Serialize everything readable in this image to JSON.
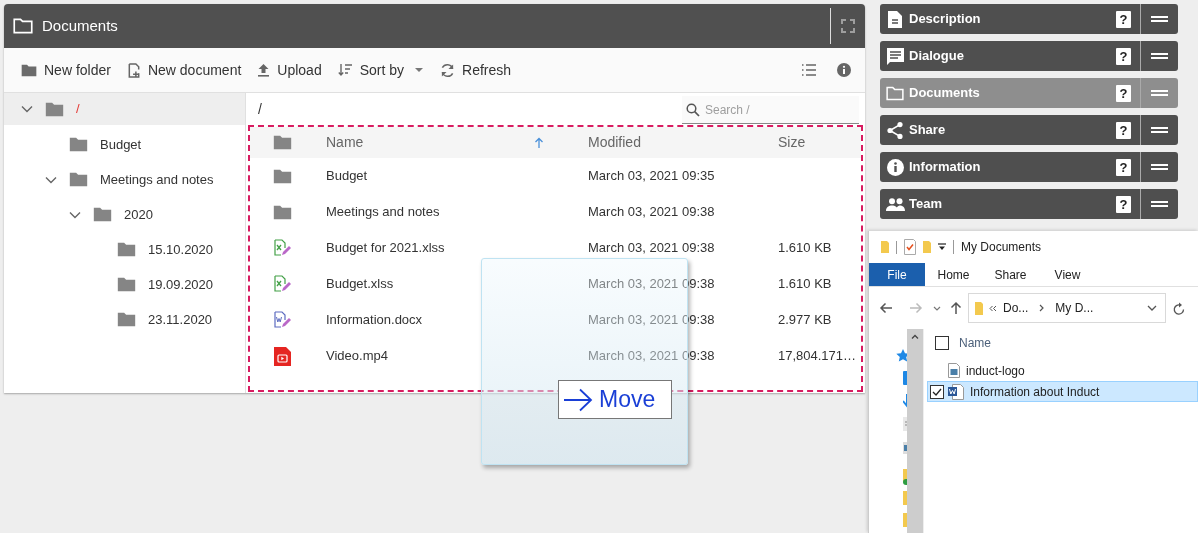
{
  "panel": {
    "title": "Documents"
  },
  "toolbar": [
    {
      "kind": "new-folder",
      "label": "New folder"
    },
    {
      "kind": "new-document",
      "label": "New document"
    },
    {
      "kind": "upload",
      "label": "Upload"
    },
    {
      "kind": "sort",
      "label": "Sort by"
    },
    {
      "kind": "refresh",
      "label": "Refresh"
    }
  ],
  "tree": {
    "label": "/",
    "selected": true,
    "expanded": true,
    "children": [
      {
        "label": "Budget",
        "selected": false
      },
      {
        "label": "Meetings and notes",
        "selected": false,
        "expanded": true,
        "children": [
          {
            "label": "2020",
            "selected": false,
            "expanded": true,
            "children": [
              {
                "label": "15.10.2020",
                "selected": false
              },
              {
                "label": "19.09.2020",
                "selected": false
              },
              {
                "label": "23.11.2020",
                "selected": false
              }
            ]
          }
        ]
      }
    ]
  },
  "path": "/",
  "search": {
    "placeholder": "Search /"
  },
  "table": {
    "columns": [
      {
        "label": "Name",
        "sorted": true
      },
      {
        "label": "Modified",
        "sorted": false
      },
      {
        "label": "Size",
        "sorted": false
      }
    ],
    "rows": [
      {
        "kind": "folder",
        "name": "Budget",
        "modified": "March 03, 2021 09:35"
      },
      {
        "kind": "folder",
        "name": "Meetings and notes",
        "modified": "March 03, 2021 09:38"
      },
      {
        "kind": "spreadsheet",
        "name": "Budget for 2021.xlss",
        "modified": "March 03, 2021 09:38",
        "size": "1.610 KB"
      },
      {
        "kind": "spreadsheet",
        "name": "Budget.xlss",
        "modified": "March 03, 2021 09:38",
        "size": "1.610 KB"
      },
      {
        "kind": "word",
        "name": "Information.docx",
        "modified": "March 03, 2021 09:38",
        "size": "2.977 KB"
      },
      {
        "kind": "video",
        "name": "Video.mp4",
        "modified": "March 03, 2021 09:38",
        "size": "17,804.171…"
      }
    ]
  },
  "drag": {
    "label": "Move"
  },
  "widgets": [
    {
      "kind": "description",
      "title": "Description",
      "selected": false,
      "help": "?"
    },
    {
      "kind": "dialogue",
      "title": "Dialogue",
      "selected": false,
      "help": "?"
    },
    {
      "kind": "documents",
      "title": "Documents",
      "selected": true,
      "help": "?"
    },
    {
      "kind": "share",
      "title": "Share",
      "selected": false,
      "help": "?"
    },
    {
      "kind": "information",
      "title": "Information",
      "selected": false,
      "help": "?"
    },
    {
      "kind": "team",
      "title": "Team",
      "selected": false,
      "help": "?"
    }
  ],
  "explorer": {
    "title": "My Documents",
    "tabs": [
      {
        "label": "File",
        "selected": true
      },
      {
        "label": "Home",
        "selected": false
      },
      {
        "label": "Share",
        "selected": false
      },
      {
        "label": "View",
        "selected": false
      }
    ],
    "address": [
      "Do...",
      "My D..."
    ],
    "column": "Name",
    "all_checked": false,
    "files": [
      {
        "kind": "image",
        "name": "induct-logo",
        "selected": false
      },
      {
        "kind": "word",
        "name": "Information about Induct",
        "selected": true
      }
    ]
  }
}
